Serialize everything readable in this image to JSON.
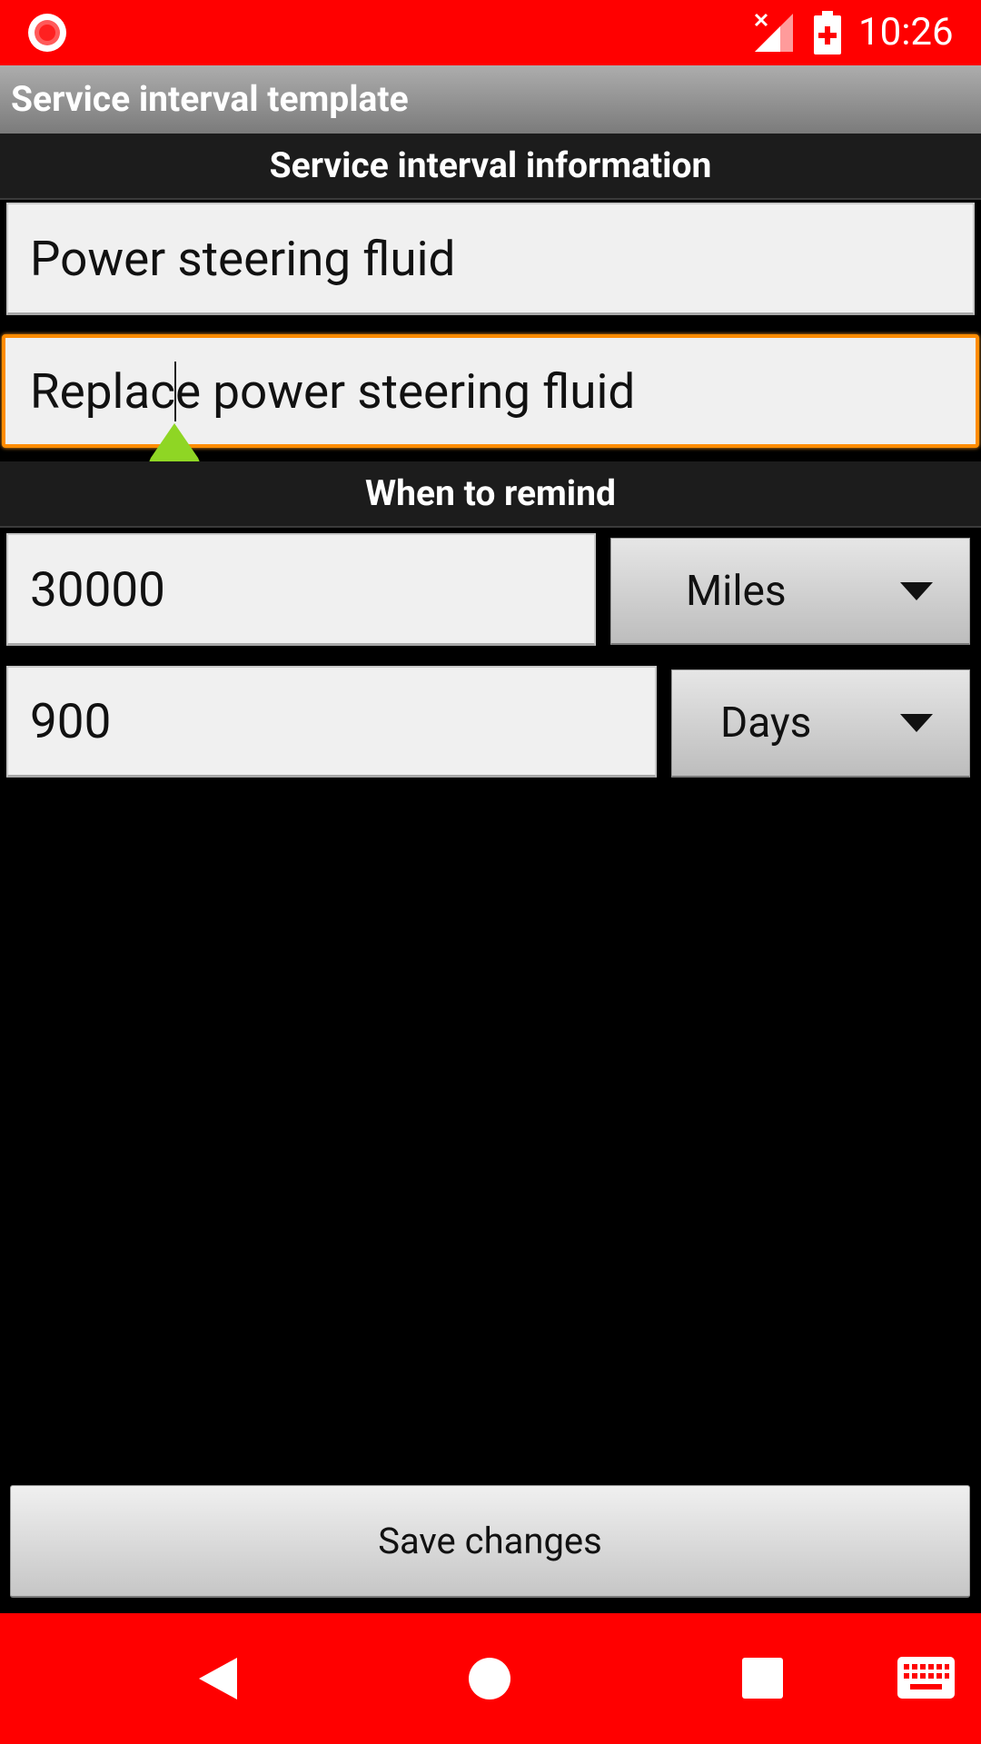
{
  "status_bar": {
    "time": "10:26",
    "icons": [
      "screen-record-icon",
      "no-signal-icon",
      "battery-charging-icon"
    ]
  },
  "title_bar": {
    "title": "Service interval template"
  },
  "info_section": {
    "header": "Service interval information",
    "name_value": "Power steering fluid",
    "description_value_before_cursor": "Replac",
    "description_value_after_cursor": "e power steering fluid"
  },
  "remind_section": {
    "header": "When to remind",
    "distance_value": "30000",
    "distance_unit": "Miles",
    "time_value": "900",
    "time_unit": "Days"
  },
  "actions": {
    "save_label": "Save changes"
  },
  "nav_bar": {
    "icons": [
      "back-icon",
      "home-icon",
      "recents-icon",
      "keyboard-icon"
    ]
  },
  "colors": {
    "system_bar": "#ff0000",
    "focus_border": "#ff8c00",
    "cursor_handle": "#8fd624"
  }
}
